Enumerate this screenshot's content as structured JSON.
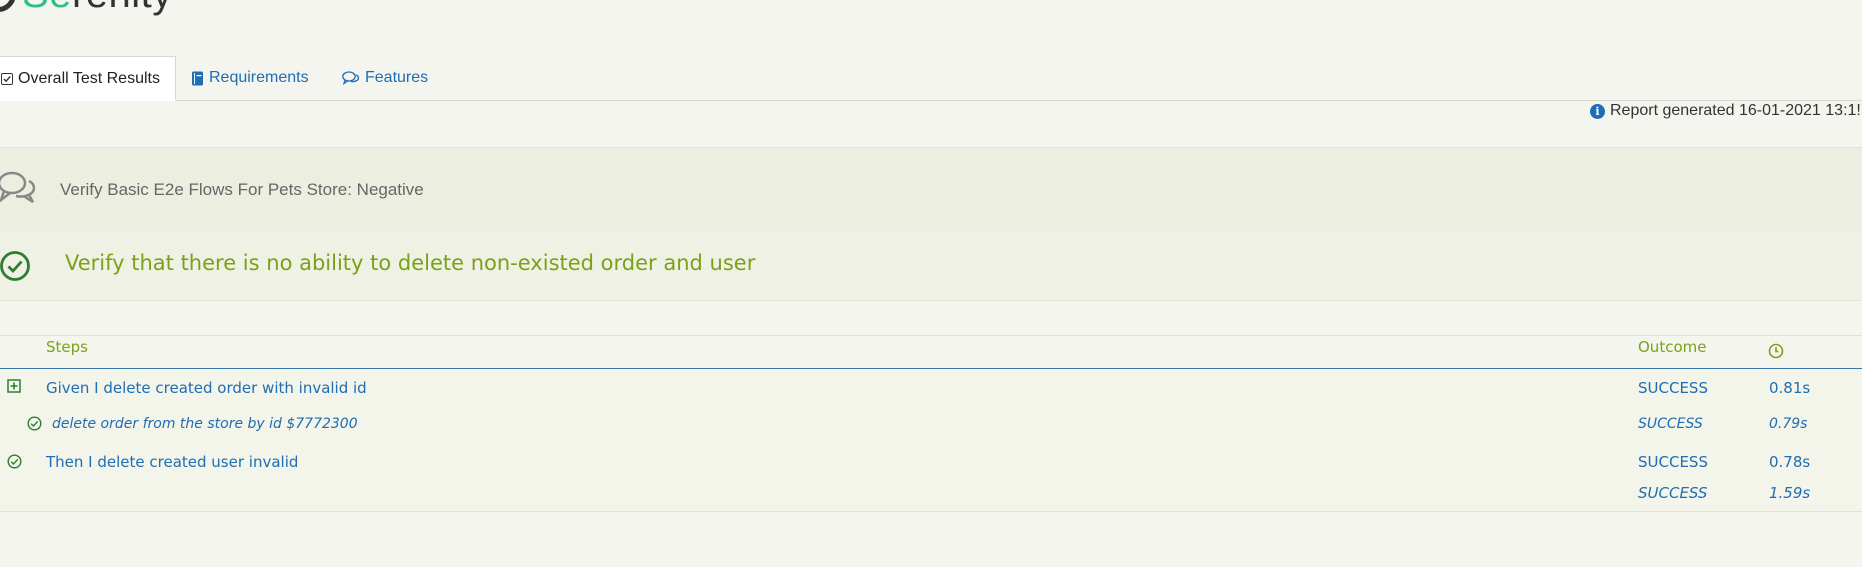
{
  "logo": {
    "text_highlight": "Se",
    "text_rest": "renity"
  },
  "tabs": [
    {
      "label": "Overall Test Results",
      "icon": "checkbox-icon",
      "active": true
    },
    {
      "label": "Requirements",
      "icon": "book-icon",
      "active": false
    },
    {
      "label": "Features",
      "icon": "comments-icon",
      "active": false
    }
  ],
  "report": {
    "text": "Report generated 16-01-2021 13:1!",
    "icon": "info-circle-icon"
  },
  "feature": {
    "title": "Verify Basic E2e Flows For Pets Store: Negative",
    "icon": "comments-icon"
  },
  "scenario": {
    "title": "Verify that there is no ability to delete non-existed order and user",
    "icon": "check-circle-icon"
  },
  "steps": {
    "headers": {
      "steps": "Steps",
      "outcome": "Outcome",
      "duration_icon": "clock-icon"
    },
    "rows": [
      {
        "text": "Given I delete created order with invalid id",
        "outcome": "SUCCESS",
        "duration": "0.81s",
        "icon": "plus-square-icon"
      },
      {
        "text": "delete order from the store by id $7772300",
        "outcome": "SUCCESS",
        "duration": "0.79s",
        "icon": "check-circle-icon"
      },
      {
        "text": "Then I delete created user invalid",
        "outcome": "SUCCESS",
        "duration": "0.78s",
        "icon": "check-circle-icon"
      }
    ],
    "total": {
      "outcome": "SUCCESS",
      "duration": "1.59s"
    }
  },
  "colors": {
    "brand": "#2cbf8a",
    "link": "#1f6db2",
    "success_green": "#7aa218",
    "check_green": "#2e7d32",
    "background": "#f5f5ef"
  }
}
